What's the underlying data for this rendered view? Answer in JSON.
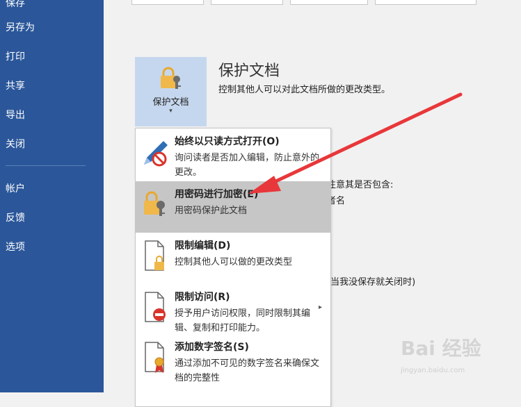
{
  "nav": {
    "items": [
      {
        "label": "保存"
      },
      {
        "label": "另存为"
      },
      {
        "label": "打印"
      },
      {
        "label": "共享"
      },
      {
        "label": "导出"
      },
      {
        "label": "关闭"
      },
      {
        "label": "帐户"
      },
      {
        "label": "反馈"
      },
      {
        "label": "选项"
      }
    ]
  },
  "protect": {
    "tile_label": "保护文档",
    "caret": "▾",
    "title": "保护文档",
    "description": "控制其他人可以对此文档所做的更改类型。"
  },
  "background_text": {
    "line1": "注意其是否包含:",
    "line2": "者名",
    "line3": "(当我没保存就关闭时)"
  },
  "menu": {
    "items": [
      {
        "title": "始终以只读方式打开(O)",
        "desc": "询问读者是否加入编辑，防止意外的更改。",
        "icon": "pencil-no-icon"
      },
      {
        "title": "用密码进行加密(E)",
        "desc": "用密码保护此文档",
        "icon": "lock-key-icon"
      },
      {
        "title": "限制编辑(D)",
        "desc": "控制其他人可以做的更改类型",
        "icon": "document-lock-icon"
      },
      {
        "title": "限制访问(R)",
        "desc": "授予用户访问权限，同时限制其编辑、复制和打印能力。",
        "icon": "document-restrict-icon",
        "submenu_arrow": "▸"
      },
      {
        "title": "添加数字签名(S)",
        "desc": "通过添加不可见的数字签名来确保文档的完整性",
        "icon": "document-ribbon-icon"
      }
    ]
  },
  "watermark": {
    "text": "Bai 经验",
    "sub": "jingyan.baidu.com"
  },
  "colors": {
    "nav_bg": "#2b579a",
    "tile_bg": "#c5d7ee",
    "active_item": "#c6c6c6",
    "arrow": "#e8373a",
    "lock": "#f0b84a"
  }
}
